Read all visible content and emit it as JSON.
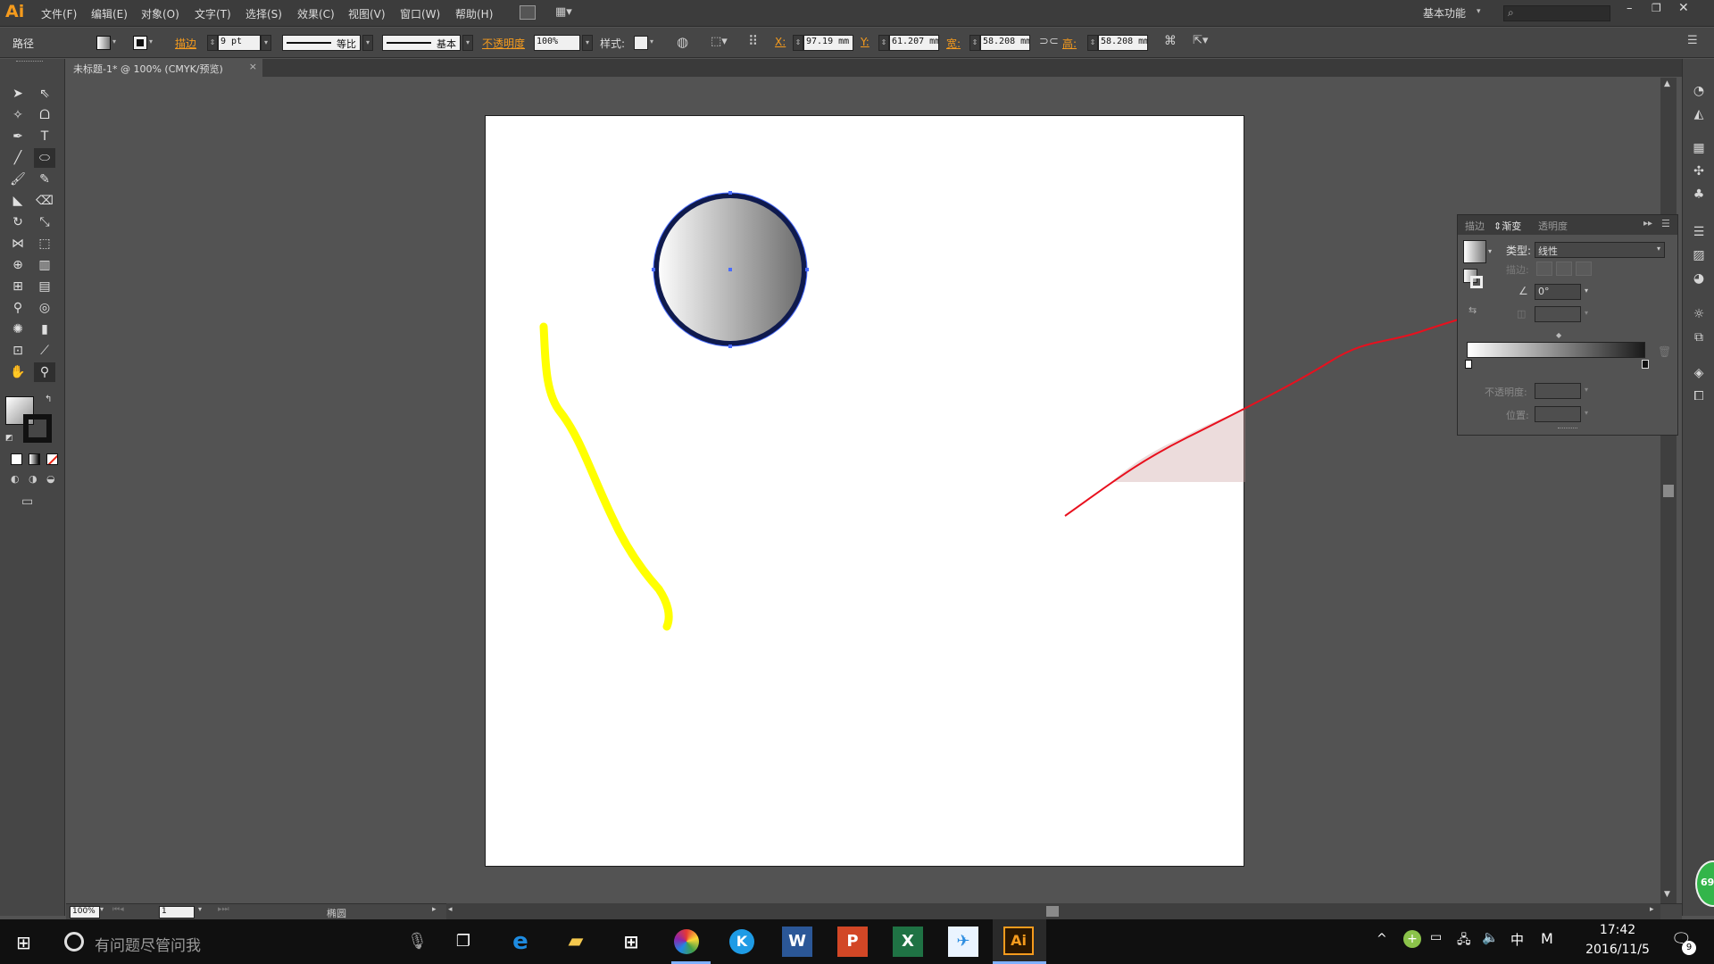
{
  "app": {
    "logo": "Ai",
    "workspace_label": "基本功能"
  },
  "menu": [
    "文件(F)",
    "编辑(E)",
    "对象(O)",
    "文字(T)",
    "选择(S)",
    "效果(C)",
    "视图(V)",
    "窗口(W)",
    "帮助(H)"
  ],
  "control": {
    "object_type": "路径",
    "stroke_label": "描边",
    "stroke_weight": "9 pt",
    "profile_label": "等比",
    "brush_label": "基本",
    "opacity_label": "不透明度",
    "opacity_value": "100%",
    "style_label": "样式:",
    "x_label": "X:",
    "x_value": "97.19 mm",
    "y_label": "Y:",
    "y_value": "61.207 mm",
    "w_label": "宽:",
    "w_value": "58.208 mm",
    "h_label": "高:",
    "h_value": "58.208 mm"
  },
  "document": {
    "tab_title": "未标题-1* @ 100% (CMYK/预览)",
    "close": "×"
  },
  "gradient_panel": {
    "tabs": [
      "描边",
      "渐变",
      "透明度"
    ],
    "type_label": "类型:",
    "type_value": "线性",
    "stroke_label": "描边:",
    "angle_value": "0°",
    "opacity_label": "不透明度:",
    "location_label": "位置:"
  },
  "status": {
    "zoom": "100%",
    "page": "1",
    "tool_name": "椭圆"
  },
  "taskbar": {
    "search_placeholder": "有问题尽管问我",
    "ime": "中",
    "ime2": "M",
    "time": "17:42",
    "date": "2016/11/5",
    "notification_count": "9",
    "badge": "69",
    "apps": [
      "task-view",
      "edge",
      "file-explorer",
      "store",
      "photos",
      "k-app",
      "word",
      "powerpoint",
      "excel",
      "bird-app",
      "illustrator"
    ]
  },
  "colors": {
    "accent": "#f59b1d",
    "annotation_red": "#e8101e",
    "yellow_stroke": "#ffff00",
    "circle_stroke": "#0f1a4d"
  }
}
